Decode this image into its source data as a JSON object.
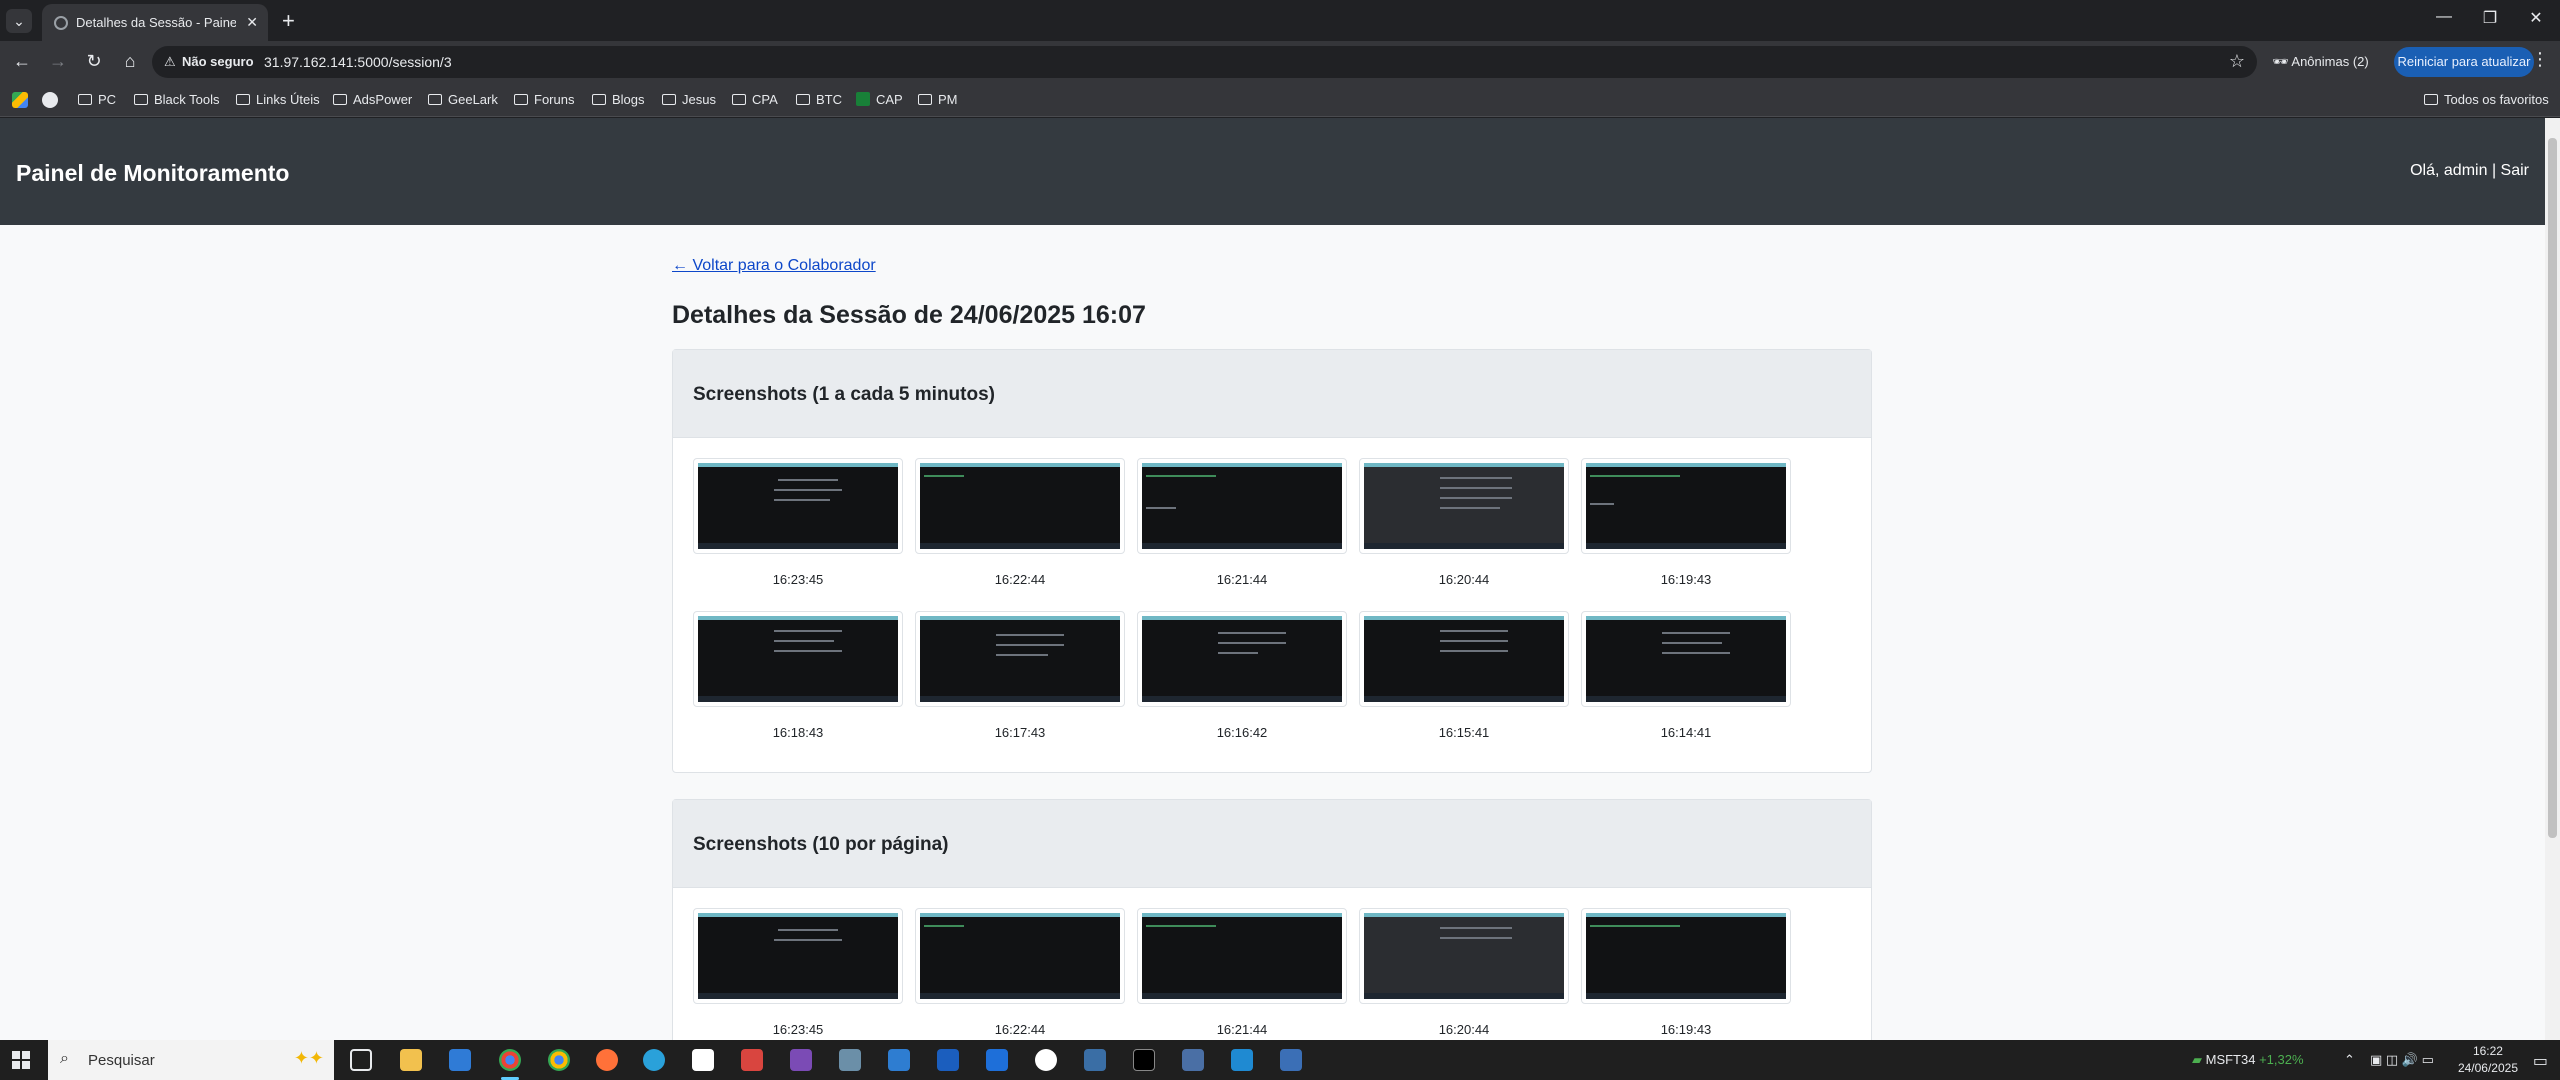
{
  "browser": {
    "tab_title": "Detalhes da Sessão - Painel de",
    "security_label": "Não seguro",
    "url": "31.97.162.141:5000/session/3",
    "incognito_label": "Anônimas (2)",
    "restart_label": "Reiniciar para atualizar",
    "bookmarks": [
      "PC",
      "Black Tools",
      "Links Úteis",
      "AdsPower",
      "GeeLark",
      "Foruns",
      "Blogs",
      "Jesus",
      "CPA",
      "BTC",
      "CAP",
      "PM"
    ],
    "all_bookmarks": "Todos os favoritos"
  },
  "app": {
    "title": "Painel de Monitoramento",
    "greeting": "Olá, admin",
    "separator": "|",
    "logout": "Sair"
  },
  "main": {
    "back_link": "← Voltar para o Colaborador",
    "page_title": "Detalhes da Sessão de 24/06/2025 16:07"
  },
  "sections": [
    {
      "header": "Screenshots (1 a cada 5 minutos)",
      "times": [
        "16:23:45",
        "16:22:44",
        "16:21:44",
        "16:20:44",
        "16:19:43",
        "16:18:43",
        "16:17:43",
        "16:16:42",
        "16:15:41",
        "16:14:41"
      ]
    },
    {
      "header": "Screenshots (10 por página)",
      "times": [
        "16:23:45",
        "16:22:44",
        "16:21:44",
        "16:20:44",
        "16:19:43"
      ]
    }
  ],
  "taskbar": {
    "search_placeholder": "Pesquisar",
    "ticker_symbol": "MSFT34",
    "ticker_change": "+1,32%",
    "time": "16:22",
    "date": "24/06/2025"
  },
  "colors": {
    "header_bg": "#343a40",
    "link": "#0d47c9",
    "restart_bg": "#1a5fb4"
  }
}
